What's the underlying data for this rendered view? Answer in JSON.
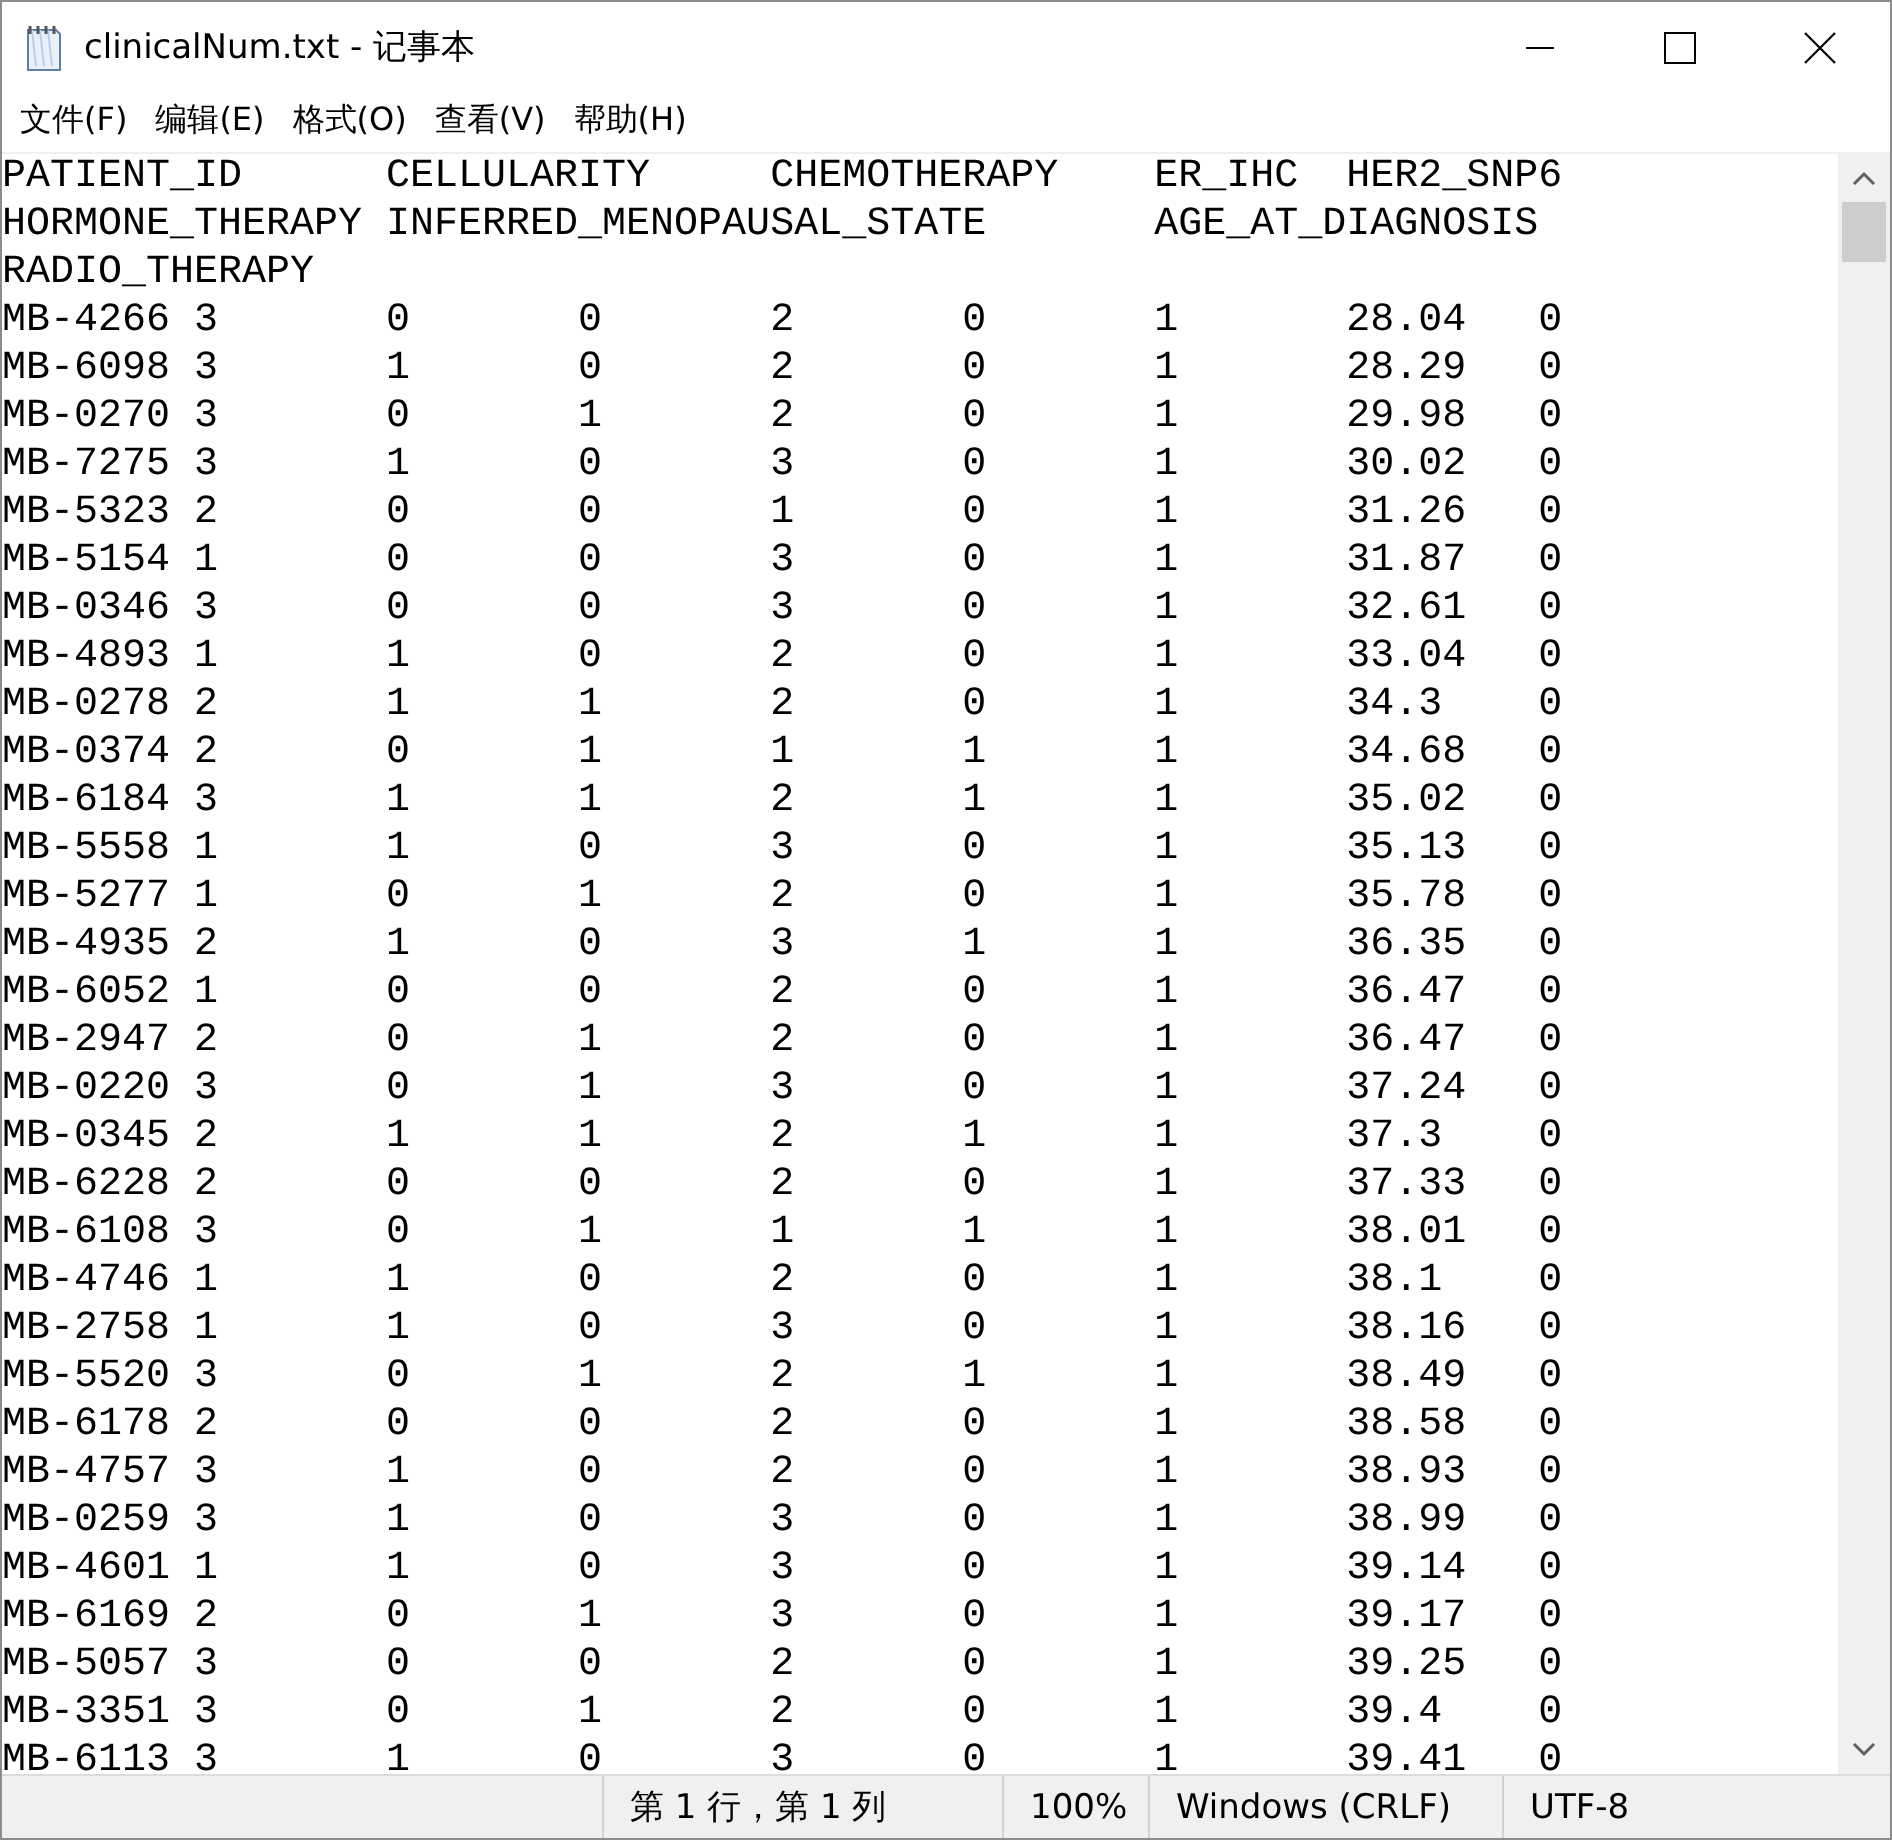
{
  "window": {
    "title": "clinicalNum.txt - 记事本"
  },
  "menu": [
    "文件(F)",
    "编辑(E)",
    "格式(O)",
    "查看(V)",
    "帮助(H)"
  ],
  "header": [
    "PATIENT_ID",
    "CELLULARITY",
    "CHEMOTHERAPY",
    "ER_IHC",
    "HER2_SNP6",
    "HORMONE_THERAPY",
    "INFERRED_MENOPAUSAL_STATE",
    "AGE_AT_DIAGNOSIS",
    "RADIO_THERAPY"
  ],
  "rows": [
    [
      "MB-4266",
      "3",
      "0",
      "0",
      "2",
      "0",
      "1",
      "28.04",
      "0"
    ],
    [
      "MB-6098",
      "3",
      "1",
      "0",
      "2",
      "0",
      "1",
      "28.29",
      "0"
    ],
    [
      "MB-0270",
      "3",
      "0",
      "1",
      "2",
      "0",
      "1",
      "29.98",
      "0"
    ],
    [
      "MB-7275",
      "3",
      "1",
      "0",
      "3",
      "0",
      "1",
      "30.02",
      "0"
    ],
    [
      "MB-5323",
      "2",
      "0",
      "0",
      "1",
      "0",
      "1",
      "31.26",
      "0"
    ],
    [
      "MB-5154",
      "1",
      "0",
      "0",
      "3",
      "0",
      "1",
      "31.87",
      "0"
    ],
    [
      "MB-0346",
      "3",
      "0",
      "0",
      "3",
      "0",
      "1",
      "32.61",
      "0"
    ],
    [
      "MB-4893",
      "1",
      "1",
      "0",
      "2",
      "0",
      "1",
      "33.04",
      "0"
    ],
    [
      "MB-0278",
      "2",
      "1",
      "1",
      "2",
      "0",
      "1",
      "34.3",
      "0"
    ],
    [
      "MB-0374",
      "2",
      "0",
      "1",
      "1",
      "1",
      "1",
      "34.68",
      "0"
    ],
    [
      "MB-6184",
      "3",
      "1",
      "1",
      "2",
      "1",
      "1",
      "35.02",
      "0"
    ],
    [
      "MB-5558",
      "1",
      "1",
      "0",
      "3",
      "0",
      "1",
      "35.13",
      "0"
    ],
    [
      "MB-5277",
      "1",
      "0",
      "1",
      "2",
      "0",
      "1",
      "35.78",
      "0"
    ],
    [
      "MB-4935",
      "2",
      "1",
      "0",
      "3",
      "1",
      "1",
      "36.35",
      "0"
    ],
    [
      "MB-6052",
      "1",
      "0",
      "0",
      "2",
      "0",
      "1",
      "36.47",
      "0"
    ],
    [
      "MB-2947",
      "2",
      "0",
      "1",
      "2",
      "0",
      "1",
      "36.47",
      "0"
    ],
    [
      "MB-0220",
      "3",
      "0",
      "1",
      "3",
      "0",
      "1",
      "37.24",
      "0"
    ],
    [
      "MB-0345",
      "2",
      "1",
      "1",
      "2",
      "1",
      "1",
      "37.3",
      "0"
    ],
    [
      "MB-6228",
      "2",
      "0",
      "0",
      "2",
      "0",
      "1",
      "37.33",
      "0"
    ],
    [
      "MB-6108",
      "3",
      "0",
      "1",
      "1",
      "1",
      "1",
      "38.01",
      "0"
    ],
    [
      "MB-4746",
      "1",
      "1",
      "0",
      "2",
      "0",
      "1",
      "38.1",
      "0"
    ],
    [
      "MB-2758",
      "1",
      "1",
      "0",
      "3",
      "0",
      "1",
      "38.16",
      "0"
    ],
    [
      "MB-5520",
      "3",
      "0",
      "1",
      "2",
      "1",
      "1",
      "38.49",
      "0"
    ],
    [
      "MB-6178",
      "2",
      "0",
      "0",
      "2",
      "0",
      "1",
      "38.58",
      "0"
    ],
    [
      "MB-4757",
      "3",
      "1",
      "0",
      "2",
      "0",
      "1",
      "38.93",
      "0"
    ],
    [
      "MB-0259",
      "3",
      "1",
      "0",
      "3",
      "0",
      "1",
      "38.99",
      "0"
    ],
    [
      "MB-4601",
      "1",
      "1",
      "0",
      "3",
      "0",
      "1",
      "39.14",
      "0"
    ],
    [
      "MB-6169",
      "2",
      "0",
      "1",
      "3",
      "0",
      "1",
      "39.17",
      "0"
    ],
    [
      "MB-5057",
      "3",
      "0",
      "0",
      "2",
      "0",
      "1",
      "39.25",
      "0"
    ],
    [
      "MB-3351",
      "3",
      "0",
      "1",
      "2",
      "0",
      "1",
      "39.4",
      "0"
    ],
    [
      "MB-6113",
      "3",
      "1",
      "0",
      "3",
      "0",
      "1",
      "39.41",
      "0"
    ]
  ],
  "status_bar": {
    "position": "第 1 行，第 1 列",
    "zoom": "100%",
    "line_ending": "Windows (CRLF)",
    "encoding": "UTF-8"
  }
}
